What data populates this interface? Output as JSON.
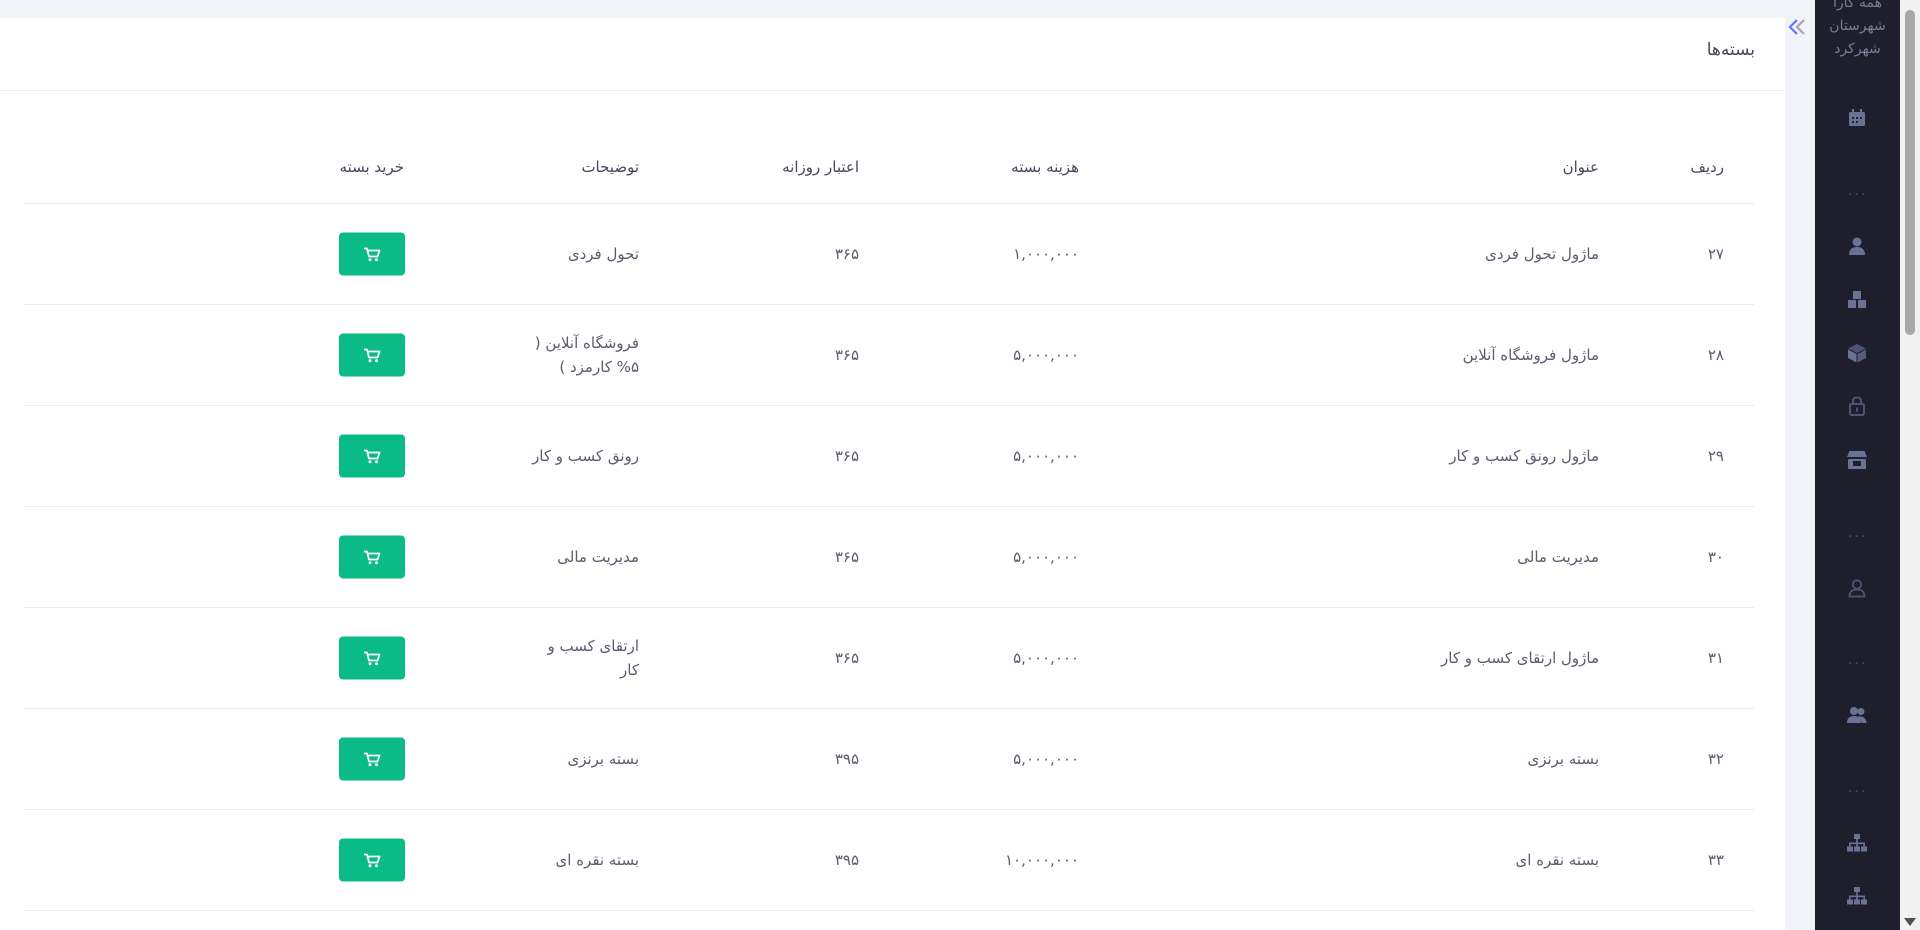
{
  "page": {
    "title": "بسته‌ها"
  },
  "sidebar": {
    "company_lines": [
      "همه کارا",
      "شهرستان",
      "شهرکرد"
    ],
    "items": [
      {
        "icon": "calendar-icon"
      },
      {
        "icon": "user-icon"
      },
      {
        "icon": "boxes-icon"
      },
      {
        "icon": "cube-icon"
      },
      {
        "icon": "lock-icon"
      },
      {
        "icon": "store-icon"
      },
      {
        "icon": "user-outline-icon"
      },
      {
        "icon": "users-icon"
      },
      {
        "icon": "sitemap-icon"
      },
      {
        "icon": "sitemap-icon"
      }
    ],
    "dots": "..."
  },
  "table": {
    "headers": {
      "row": "ردیف",
      "title": "عنوان",
      "cost": "هزینه بسته",
      "days": "اعتبار روزانه",
      "desc": "توضیحات",
      "buy": "خرید بسته"
    },
    "rows": [
      {
        "row": "۲۷",
        "title": "ماژول تحول فردی",
        "cost": "۱,۰۰۰,۰۰۰",
        "days": "۳۶۵",
        "desc": "تحول فردی"
      },
      {
        "row": "۲۸",
        "title": "ماژول فروشگاه آنلاین",
        "cost": "۵,۰۰۰,۰۰۰",
        "days": "۳۶۵",
        "desc": "فروشگاه آنلاین ( ۵% کارمزد )"
      },
      {
        "row": "۲۹",
        "title": "ماژول رونق کسب و کار",
        "cost": "۵,۰۰۰,۰۰۰",
        "days": "۳۶۵",
        "desc": "رونق کسب و کار"
      },
      {
        "row": "۳۰",
        "title": "مدیریت مالی",
        "cost": "۵,۰۰۰,۰۰۰",
        "days": "۳۶۵",
        "desc": "مدیریت مالی"
      },
      {
        "row": "۳۱",
        "title": "ماژول ارتقای کسب و کار",
        "cost": "۵,۰۰۰,۰۰۰",
        "days": "۳۶۵",
        "desc": "ارتقای کسب و کار"
      },
      {
        "row": "۳۲",
        "title": "بسته برنزی",
        "cost": "۵,۰۰۰,۰۰۰",
        "days": "۳۹۵",
        "desc": "بسته برنزی"
      },
      {
        "row": "۳۳",
        "title": "بسته نقره ای",
        "cost": "۱۰,۰۰۰,۰۰۰",
        "days": "۳۹۵",
        "desc": "بسته نقره ای"
      }
    ]
  },
  "colors": {
    "accent": "#0abb87",
    "sidebar_bg": "#1e1e2d",
    "sidebar_icon": "#6c7293"
  }
}
